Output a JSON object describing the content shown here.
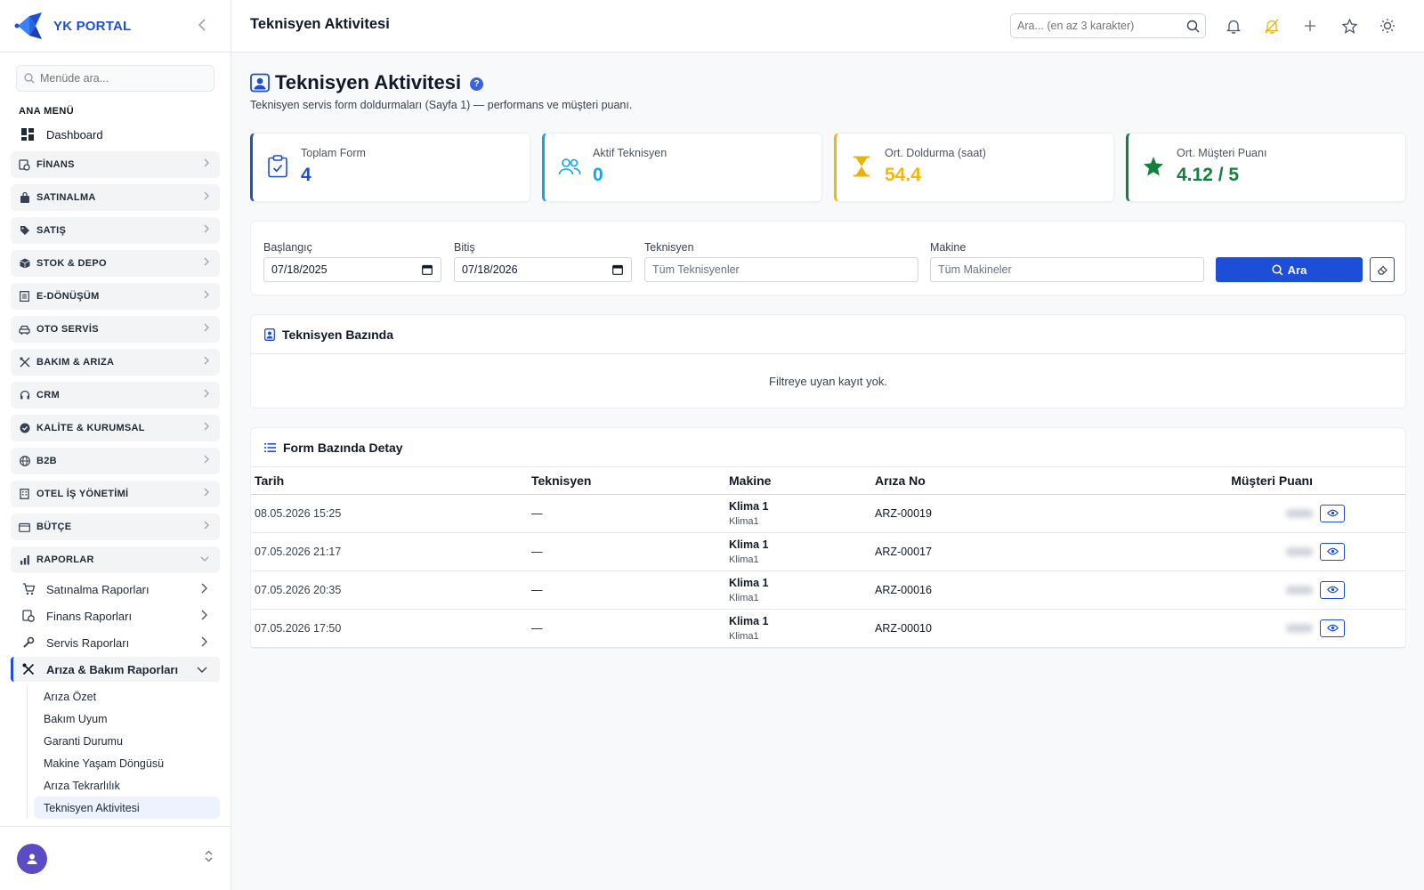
{
  "brand": {
    "name": "YK PORTAL"
  },
  "sidebar": {
    "search_placeholder": "Menüde ara...",
    "section_title": "ANA MENÜ",
    "dashboard_label": "Dashboard",
    "groups": [
      {
        "label": "FİNANS",
        "icon": "finance-icon"
      },
      {
        "label": "SATINALMA",
        "icon": "bag-icon"
      },
      {
        "label": "SATIŞ",
        "icon": "tag-icon"
      },
      {
        "label": "STOK & DEPO",
        "icon": "box-icon"
      },
      {
        "label": "E-DÖNÜŞÜM",
        "icon": "document-icon"
      },
      {
        "label": "OTO SERVİS",
        "icon": "car-icon"
      },
      {
        "label": "BAKIM & ARIZA",
        "icon": "tools-icon"
      },
      {
        "label": "CRM",
        "icon": "headset-icon"
      },
      {
        "label": "KALİTE & KURUMSAL",
        "icon": "badge-icon"
      },
      {
        "label": "B2B",
        "icon": "globe-icon"
      },
      {
        "label": "OTEL İŞ YÖNETİMİ",
        "icon": "building-icon"
      },
      {
        "label": "BÜTÇE",
        "icon": "wallet-icon"
      },
      {
        "label": "RAPORLAR",
        "icon": "chart-icon"
      }
    ],
    "report_subs": [
      {
        "label": "Satınalma Raporları",
        "icon": "cart-icon"
      },
      {
        "label": "Finans Raporları",
        "icon": "finance-icon"
      },
      {
        "label": "Servis Raporları",
        "icon": "wrench-icon"
      },
      {
        "label": "Arıza & Bakım Raporları",
        "icon": "tools-icon"
      }
    ],
    "leaves": [
      "Arıza Özet",
      "Bakım Uyum",
      "Garanti Durumu",
      "Makine Yaşam Döngüsü",
      "Arıza Tekrarlılık",
      "Teknisyen Aktivitesi"
    ]
  },
  "topbar": {
    "title": "Teknisyen Aktivitesi",
    "search_placeholder": "Ara... (en az 3 karakter)"
  },
  "page": {
    "title": "Teknisyen Aktivitesi",
    "help": "?",
    "subtitle": "Teknisyen servis form doldurmaları (Sayfa 1) — performans ve müşteri puanı."
  },
  "kpis": [
    {
      "label": "Toplam Form",
      "value": "4",
      "color": "#1d4ed8",
      "icon": "clipboard-check-icon"
    },
    {
      "label": "Aktif Teknisyen",
      "value": "0",
      "color": "#0ea5e9",
      "icon": "users-icon"
    },
    {
      "label": "Ort. Doldurma (saat)",
      "value": "54.4",
      "color": "#f5b70b",
      "icon": "hourglass-icon"
    },
    {
      "label": "Ort. Müşteri Puanı",
      "value": "4.12 / 5",
      "color": "#15803d",
      "icon": "star-icon"
    }
  ],
  "filters": {
    "start_label": "Başlangıç",
    "start_value": "07/18/2025",
    "end_label": "Bitiş",
    "end_value": "07/18/2026",
    "tech_label": "Teknisyen",
    "tech_value": "Tüm Teknisyenler",
    "machine_label": "Makine",
    "machine_value": "Tüm Makineler",
    "search_button": "Ara"
  },
  "tech_section": {
    "title": "Teknisyen Bazında",
    "empty_text": "Filtreye uyan kayıt yok."
  },
  "detail_section": {
    "title": "Form Bazında Detay",
    "columns": [
      "Tarih",
      "Teknisyen",
      "Makine",
      "Arıza No",
      "Müşteri Puanı"
    ],
    "rows": [
      {
        "date": "08.05.2026 15:25",
        "tech": "—",
        "machine": "Klima 1",
        "machine_sub": "Klima1",
        "fault": "ARZ-00019"
      },
      {
        "date": "07.05.2026 21:17",
        "tech": "—",
        "machine": "Klima 1",
        "machine_sub": "Klima1",
        "fault": "ARZ-00017"
      },
      {
        "date": "07.05.2026 20:35",
        "tech": "—",
        "machine": "Klima 1",
        "machine_sub": "Klima1",
        "fault": "ARZ-00016"
      },
      {
        "date": "07.05.2026 17:50",
        "tech": "—",
        "machine": "Klima 1",
        "machine_sub": "Klima1",
        "fault": "ARZ-00010"
      }
    ]
  }
}
